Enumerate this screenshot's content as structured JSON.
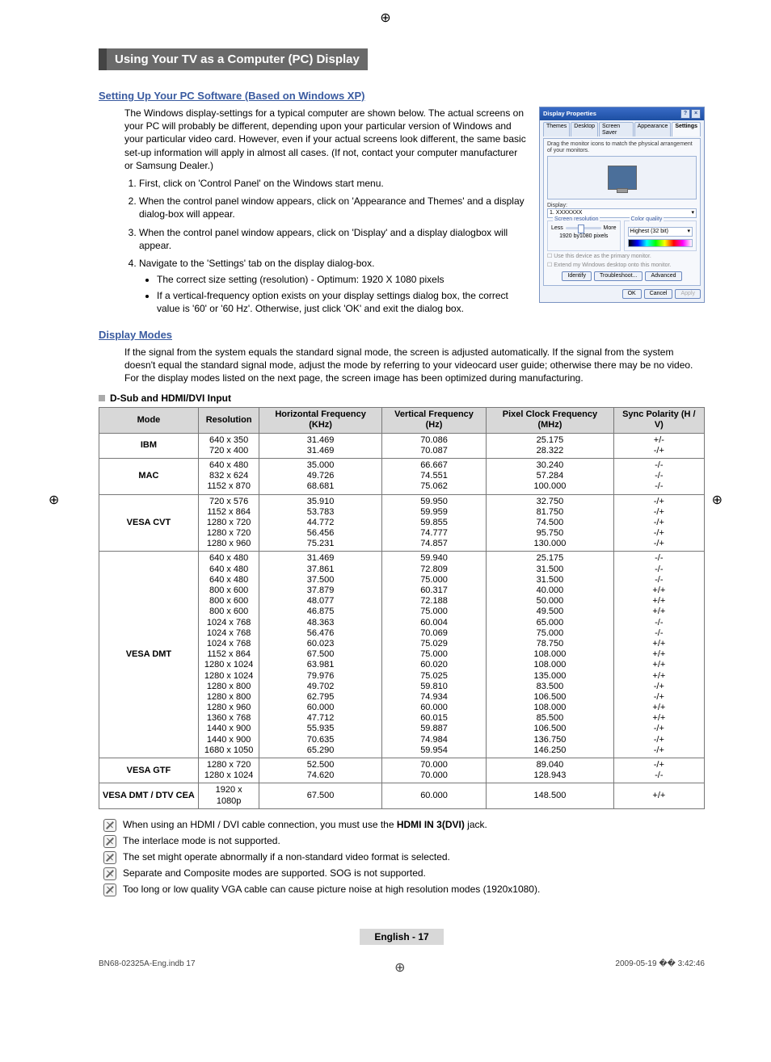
{
  "section_title": "Using Your TV as a Computer (PC) Display",
  "setup": {
    "heading": "Setting Up Your PC Software (Based on Windows XP)",
    "intro": "The Windows display-settings for a typical computer are shown below. The actual screens on your PC will probably be different, depending upon your particular version of Windows and your particular video card. However, even if your actual screens look different, the same basic set-up information will apply in almost all cases. (If not, contact your computer manufacturer or Samsung Dealer.)",
    "steps": [
      "First, click on 'Control Panel' on the Windows start menu.",
      "When the control panel window appears, click on 'Appearance and Themes' and a display dialog-box will appear.",
      "When the control panel window appears, click on 'Display' and a display dialogbox will appear.",
      "Navigate to the 'Settings' tab on the display dialog-box."
    ],
    "sub_bullets": [
      "The correct size setting (resolution) - Optimum: 1920 X 1080 pixels",
      "If a vertical-frequency option exists on your display settings dialog box, the correct value is '60' or '60 Hz'. Otherwise, just click 'OK' and exit the dialog box."
    ]
  },
  "dialog": {
    "title": "Display Properties",
    "tabs": [
      "Themes",
      "Desktop",
      "Screen Saver",
      "Appearance",
      "Settings"
    ],
    "active_tab": 4,
    "drag_text": "Drag the monitor icons to match the physical arrangement of your monitors.",
    "display_label": "Display:",
    "display_value": "1. XXXXXXX",
    "res_legend": "Screen resolution",
    "res_less": "Less",
    "res_more": "More",
    "res_value": "1920 by1080 pixels",
    "cq_legend": "Color quality",
    "cq_value": "Highest (32 bit)",
    "check1": "Use this device as the primary monitor.",
    "check2": "Extend my Windows desktop onto this monitor.",
    "btn_identify": "Identify",
    "btn_trouble": "Troubleshoot...",
    "btn_adv": "Advanced",
    "btn_ok": "OK",
    "btn_cancel": "Cancel",
    "btn_apply": "Apply"
  },
  "display_modes": {
    "heading": "Display Modes",
    "intro": "If the signal from the system equals the standard signal mode, the screen is adjusted automatically. If the signal from the system doesn't equal the standard signal mode, adjust the mode by referring to your videocard user guide; otherwise there may be no video. For the display modes listed on the next page, the screen image has been optimized during manufacturing.",
    "table_label": "D-Sub and HDMI/DVI Input",
    "headers": {
      "mode": "Mode",
      "resolution": "Resolution",
      "hfreq": "Horizontal Frequency (KHz)",
      "vfreq": "Vertical Frequency (Hz)",
      "pclock": "Pixel Clock Frequency (MHz)",
      "sync": "Sync Polarity (H / V)"
    },
    "rows": [
      {
        "mode": "IBM",
        "res": "640 x 350\n720 x 400",
        "hf": "31.469\n31.469",
        "vf": "70.086\n70.087",
        "pc": "25.175\n28.322",
        "sp": "+/-\n-/+"
      },
      {
        "mode": "MAC",
        "res": "640 x 480\n832 x 624\n1152 x 870",
        "hf": "35.000\n49.726\n68.681",
        "vf": "66.667\n74.551\n75.062",
        "pc": "30.240\n57.284\n100.000",
        "sp": "-/-\n-/-\n-/-"
      },
      {
        "mode": "VESA CVT",
        "res": "720 x 576\n1152 x 864\n1280 x 720\n1280 x 720\n1280 x 960",
        "hf": "35.910\n53.783\n44.772\n56.456\n75.231",
        "vf": "59.950\n59.959\n59.855\n74.777\n74.857",
        "pc": "32.750\n81.750\n74.500\n95.750\n130.000",
        "sp": "-/+\n-/+\n-/+\n-/+\n-/+"
      },
      {
        "mode": "VESA DMT",
        "res": "640 x 480\n640 x 480\n640 x 480\n800 x 600\n800 x 600\n800 x 600\n1024 x 768\n1024 x 768\n1024 x 768\n1152 x 864\n1280 x 1024\n1280 x 1024\n1280 x 800\n1280 x 800\n1280 x 960\n1360 x 768\n1440 x 900\n1440 x 900\n1680 x 1050",
        "hf": "31.469\n37.861\n37.500\n37.879\n48.077\n46.875\n48.363\n56.476\n60.023\n67.500\n63.981\n79.976\n49.702\n62.795\n60.000\n47.712\n55.935\n70.635\n65.290",
        "vf": "59.940\n72.809\n75.000\n60.317\n72.188\n75.000\n60.004\n70.069\n75.029\n75.000\n60.020\n75.025\n59.810\n74.934\n60.000\n60.015\n59.887\n74.984\n59.954",
        "pc": "25.175\n31.500\n31.500\n40.000\n50.000\n49.500\n65.000\n75.000\n78.750\n108.000\n108.000\n135.000\n83.500\n106.500\n108.000\n85.500\n106.500\n136.750\n146.250",
        "sp": "-/-\n-/-\n-/-\n+/+\n+/+\n+/+\n-/-\n-/-\n+/+\n+/+\n+/+\n+/+\n-/+\n-/+\n+/+\n+/+\n-/+\n-/+\n-/+"
      },
      {
        "mode": "VESA GTF",
        "res": "1280 x 720\n1280 x 1024",
        "hf": "52.500\n74.620",
        "vf": "70.000\n70.000",
        "pc": "89.040\n128.943",
        "sp": "-/+\n-/-"
      },
      {
        "mode": "VESA DMT / DTV CEA",
        "res": "1920 x 1080p",
        "hf": "67.500",
        "vf": "60.000",
        "pc": "148.500",
        "sp": "+/+"
      }
    ]
  },
  "notes": [
    "When using an HDMI / DVI cable connection, you must use the HDMI IN 3(DVI) jack.",
    "The interlace mode is not supported.",
    "The set might operate abnormally if a non-standard video format is selected.",
    "Separate and Composite modes are supported. SOG is not supported.",
    "Too long or low quality VGA cable can cause picture noise at high resolution modes (1920x1080)."
  ],
  "note_bold_fragment": "HDMI IN 3(DVI)",
  "page_label": "English - 17",
  "footer_left": "BN68-02325A-Eng.indb   17",
  "footer_right": "2009-05-19   �� 3:42:46"
}
